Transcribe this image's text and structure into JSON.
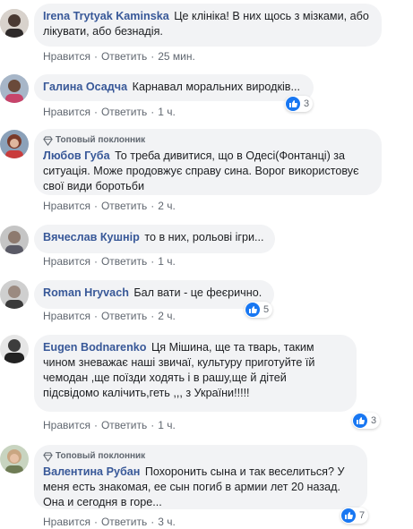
{
  "ui": {
    "like_label": "Нравится",
    "reply_label": "Ответить",
    "top_fan_label": "Топовый поклонник"
  },
  "comments": [
    {
      "author": "Irena Trytyak Kaminska",
      "text": "Це клініка! В них щось з мізками, або лікувати, або безнадія.",
      "time": "25 мин.",
      "reactions": ""
    },
    {
      "author": "Галина Осадча",
      "text": "Карнавал моральних виродків...",
      "time": "1 ч.",
      "reactions": "3"
    },
    {
      "author": "Любов Губа",
      "text": "То треба дивитися, що в Одесі(Фонтанці) за ситуація. Може продовжує справу сина. Ворог використовує свої види боротьби",
      "time": "2 ч.",
      "reactions": ""
    },
    {
      "author": "Вячеслав Кушнір",
      "text": "то в них, рольові ігри...",
      "time": "1 ч.",
      "reactions": ""
    },
    {
      "author": "Roman Hryvach",
      "text": "Бал вати - це феєрично.",
      "time": "2 ч.",
      "reactions": "5"
    },
    {
      "author": "Eugen Bodnarenko",
      "text": "Ця Мішина, ще та тварь, таким чином зневажає наші звичаї, культуру приготуйте їй чемодан ,ще поїзди ходять і в рашу,ще й дітей підсвідомо калічить,геть ,,, з України!!!!!",
      "time": "1 ч.",
      "reactions": "3"
    },
    {
      "author": "Валентина Рубан",
      "text": "Похоронить сына и так веселиться? У меня есть знакомая, ее сын погиб в армии лет 20 назад. Она и сегодня в горе...",
      "time": "3 ч.",
      "reactions": "7"
    }
  ],
  "colors": {
    "author": "#385898",
    "bubble": "#f2f3f5",
    "meta": "#606770",
    "like": "#1877f2"
  }
}
